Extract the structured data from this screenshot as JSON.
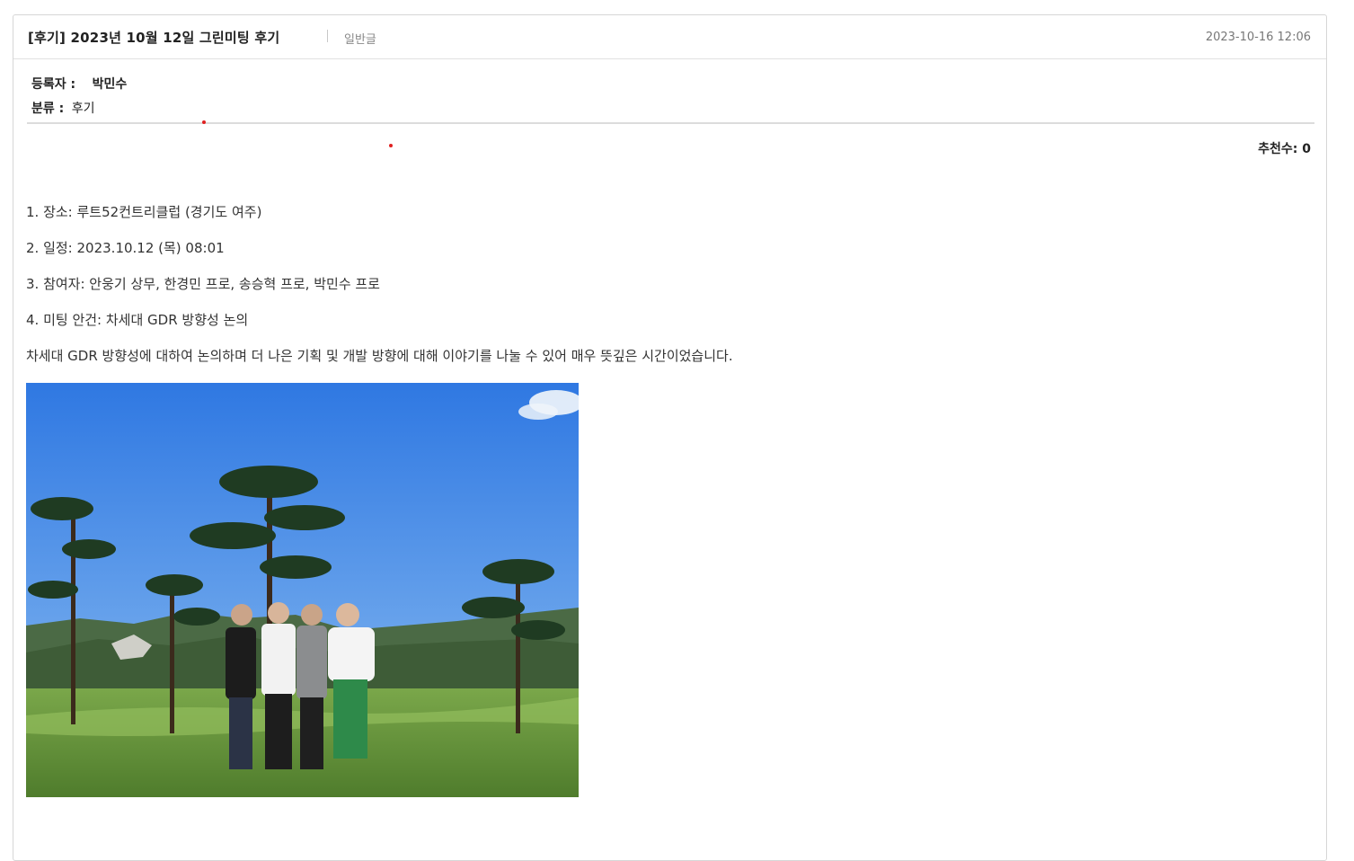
{
  "post": {
    "title": "[후기] 2023년 10월 12일 그린미팅 후기",
    "kind": "일반글",
    "date": "2023-10-16 12:06"
  },
  "meta": {
    "author_label": "등록자 :",
    "author": "박민수",
    "category_label": "분류 :",
    "category": "후기"
  },
  "recommend": {
    "label": "추천수:",
    "count": "0"
  },
  "body": {
    "lines": [
      "1. 장소: 루트52컨트리클럽 (경기도 여주)",
      "2. 일정: 2023.10.12 (목) 08:01",
      "3. 참여자: 안웅기 상무, 한경민 프로, 송승혁 프로, 박민수 프로",
      "4. 미팅 안건: 차세대 GDR 방향성 논의",
      "차세대 GDR 방향성에 대하여 논의하며 더 나은 기획 및 개발 방향에 대해 이야기를 나눌 수 있어 매우 뜻깊은 시간이었습니다."
    ]
  },
  "colors": {
    "border": "#d6d6d6",
    "accent_dot": "#e02020",
    "sky": "#3f86e8",
    "grass": "#5f8f3a"
  }
}
